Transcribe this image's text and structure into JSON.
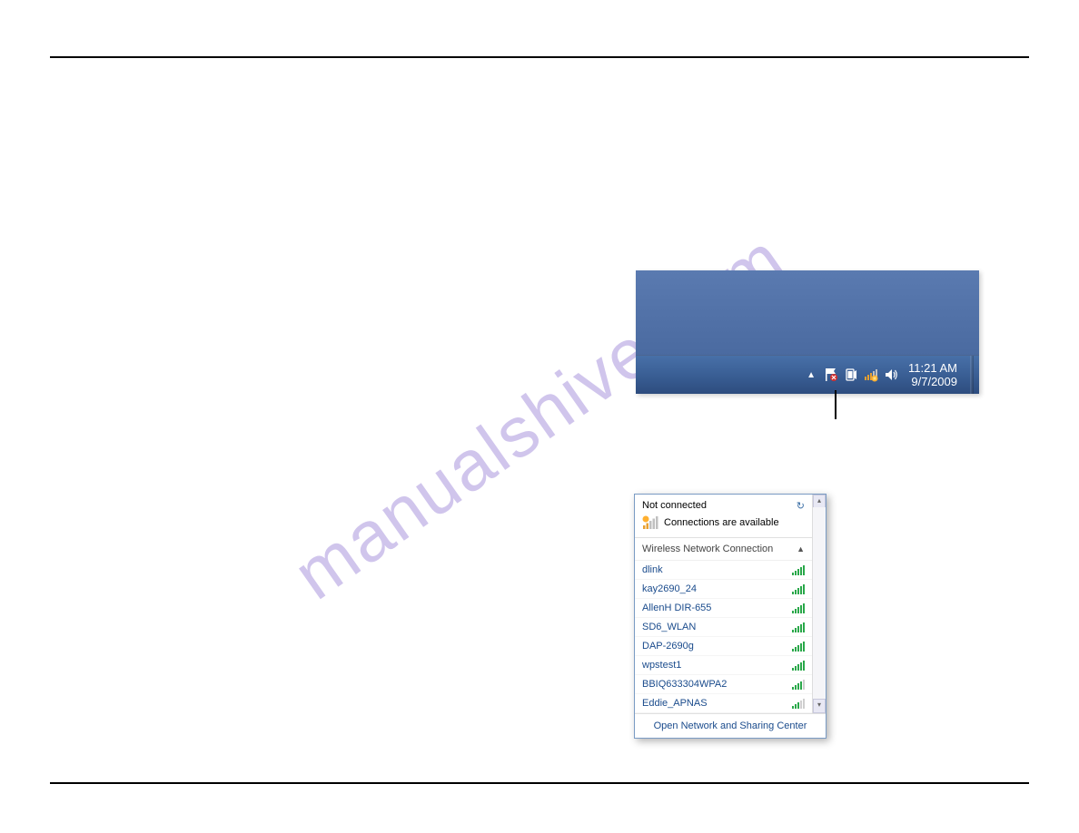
{
  "watermark": "manualshive.com",
  "taskbar": {
    "time": "11:21 AM",
    "date": "9/7/2009"
  },
  "wifi_popup": {
    "status_title": "Not connected",
    "available_text": "Connections are available",
    "section_title": "Wireless Network Connection",
    "networks": [
      {
        "name": "dlink",
        "signal": 5
      },
      {
        "name": "kay2690_24",
        "signal": 5
      },
      {
        "name": "AllenH DIR-655",
        "signal": 5
      },
      {
        "name": "SD6_WLAN",
        "signal": 5
      },
      {
        "name": "DAP-2690g",
        "signal": 5
      },
      {
        "name": "wpstest1",
        "signal": 5
      },
      {
        "name": "BBIQ633304WPA2",
        "signal": 4
      },
      {
        "name": "Eddie_APNAS",
        "signal": 3
      }
    ],
    "footer_link": "Open Network and Sharing Center"
  }
}
